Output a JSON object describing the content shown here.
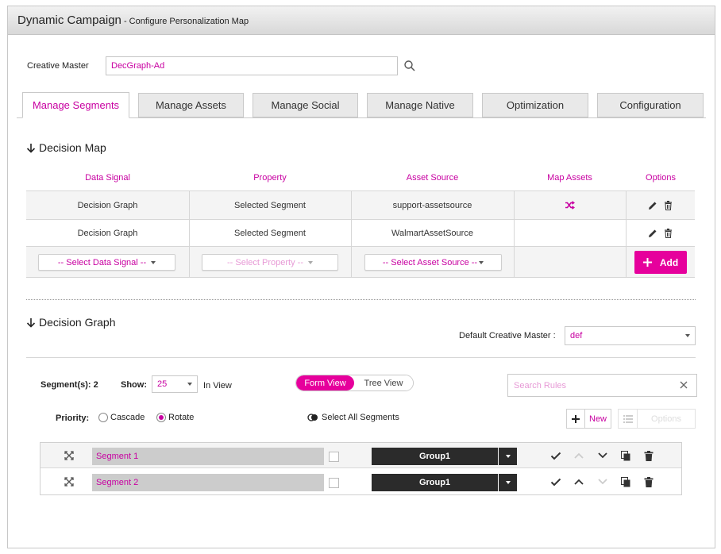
{
  "header": {
    "app_title": "Dynamic Campaign",
    "subtitle": " - Configure Personalization Map"
  },
  "creative_master": {
    "label": "Creative Master",
    "value": "DecGraph-Ad"
  },
  "tabs": [
    {
      "label": "Manage Segments",
      "active": true
    },
    {
      "label": "Manage Assets",
      "active": false
    },
    {
      "label": "Manage Social",
      "active": false
    },
    {
      "label": "Manage Native",
      "active": false
    },
    {
      "label": "Optimization",
      "active": false
    },
    {
      "label": "Configuration",
      "active": false
    }
  ],
  "decision_map": {
    "title": "Decision Map",
    "columns": [
      "Data Signal",
      "Property",
      "Asset Source",
      "Map Assets",
      "Options"
    ],
    "rows": [
      {
        "data_signal": "Decision Graph",
        "property": "Selected Segment",
        "asset_source": "support-assetsource",
        "map_assets_icon": "shuffle-icon"
      },
      {
        "data_signal": "Decision Graph",
        "property": "Selected Segment",
        "asset_source": "WalmartAssetSource",
        "map_assets_icon": ""
      }
    ],
    "selects": {
      "data_signal": "-- Select Data Signal --",
      "property": "-- Select Property --",
      "asset_source": "-- Select Asset Source --"
    },
    "add_label": "Add"
  },
  "decision_graph": {
    "title": "Decision Graph",
    "default_cm_label": "Default Creative Master :",
    "default_cm_value": "def",
    "segments_label": "Segment(s): 2",
    "show_label": "Show:",
    "show_value": "25",
    "in_view_label": "In View",
    "view_toggle": {
      "form": "Form View",
      "tree": "Tree View",
      "active": "form"
    },
    "search_placeholder": "Search Rules",
    "priority_label": "Priority:",
    "priority_options": [
      {
        "label": "Cascade",
        "selected": false
      },
      {
        "label": "Rotate",
        "selected": true
      }
    ],
    "select_all_label": "Select All Segments",
    "new_label": "New",
    "options_label": "Options",
    "segments": [
      {
        "name": "Segment 1",
        "group": "Group1",
        "up_enabled": false,
        "down_enabled": true
      },
      {
        "name": "Segment 2",
        "group": "Group1",
        "up_enabled": true,
        "down_enabled": false
      }
    ]
  },
  "colors": {
    "accent": "#c800a1",
    "accent_button": "#e6009c",
    "dark": "#2b2b2b"
  }
}
